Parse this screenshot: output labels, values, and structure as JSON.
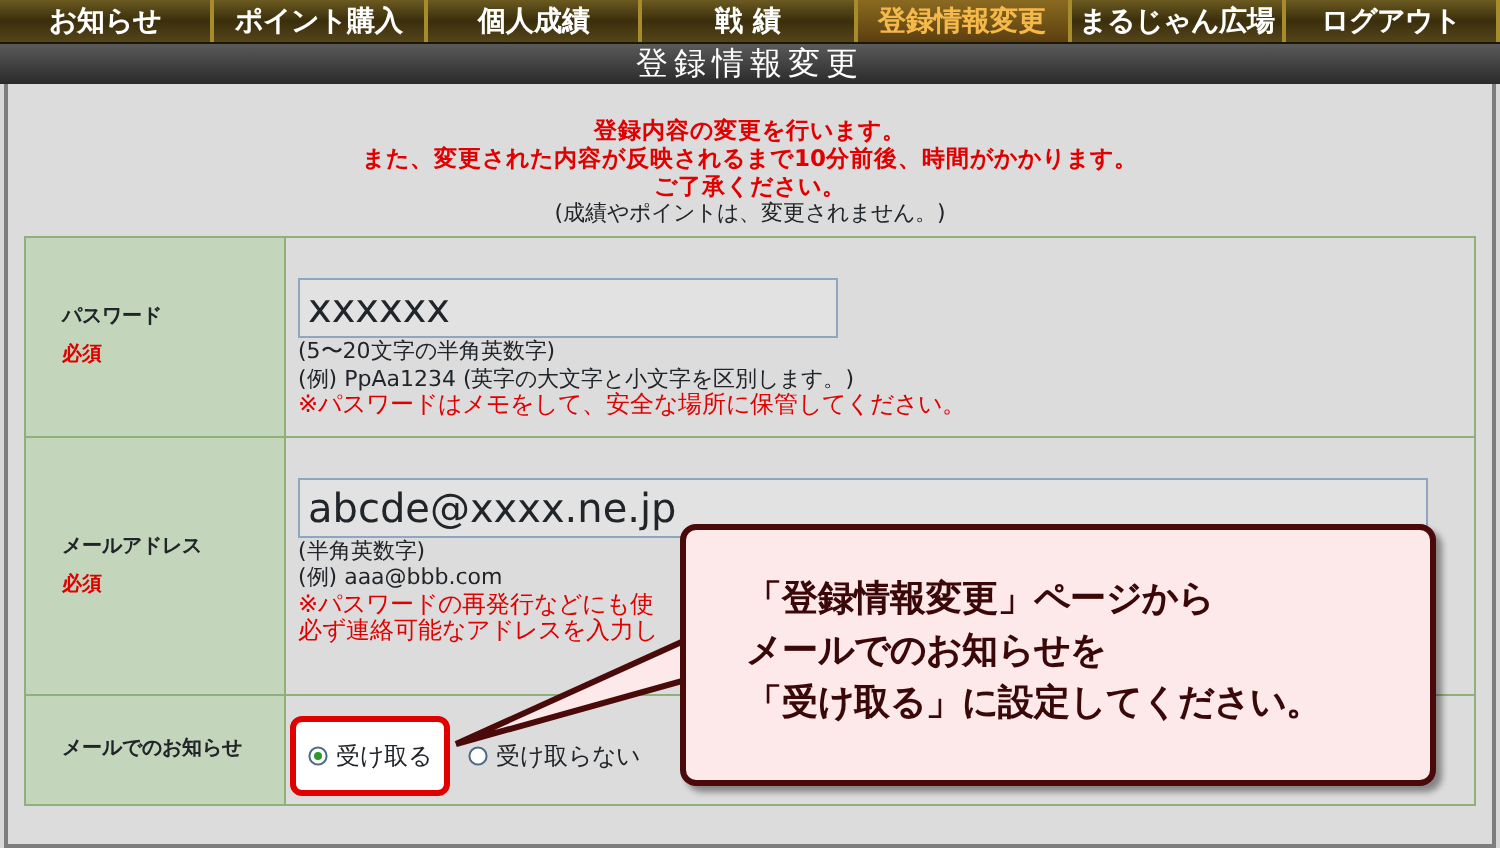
{
  "nav": [
    {
      "label": "お知らせ",
      "selected": false
    },
    {
      "label": "ポイント購入",
      "selected": false
    },
    {
      "label": "個人成績",
      "selected": false
    },
    {
      "label": "戦 績",
      "selected": false
    },
    {
      "label": "登録情報変更",
      "selected": true
    },
    {
      "label": "まるじゃん広場",
      "selected": false
    },
    {
      "label": "ログアウト",
      "selected": false
    }
  ],
  "page_title": "登録情報変更",
  "notice": {
    "lines": [
      "登録内容の変更を行います。",
      "また、変更された内容が反映されるまで10分前後、時間がかかります。",
      "ご了承ください。"
    ],
    "note": "(成績やポイントは、変更されません。)"
  },
  "form": [
    {
      "kind": "text",
      "label": "パスワード",
      "required": "必須",
      "value": "xxxxxx",
      "hints": [
        {
          "text": "(5〜20文字の半角英数字)",
          "warning": false
        },
        {
          "text": "(例)  PpAa1234 (英字の大文字と小文字を区別します。)",
          "warning": false
        },
        {
          "text": "※パスワードはメモをして、安全な場所に保管してください。",
          "warning": true
        }
      ]
    },
    {
      "kind": "wide",
      "label": "メールアドレス",
      "required": "必須",
      "value": "abcde@xxxx.ne.jp",
      "hints": [
        {
          "text": "(半角英数字)",
          "warning": false
        },
        {
          "text": "(例)  aaa@bbb.com",
          "warning": false
        },
        {
          "text": "※パスワードの再発行などにも使",
          "warning": true
        },
        {
          "text": "必ず連絡可能なアドレスを入力し",
          "warning": true
        }
      ]
    },
    {
      "kind": "radio",
      "label": "メールでのお知らせ",
      "options": [
        {
          "label": "受け取る",
          "selected": true,
          "highlighted": true
        },
        {
          "label": "受け取らない",
          "selected": false,
          "highlighted": false
        }
      ]
    }
  ],
  "callout": {
    "lines": [
      "「登録情報変更」ページから",
      "メールでのお知らせを",
      "「受け取る」に設定してください。"
    ]
  }
}
